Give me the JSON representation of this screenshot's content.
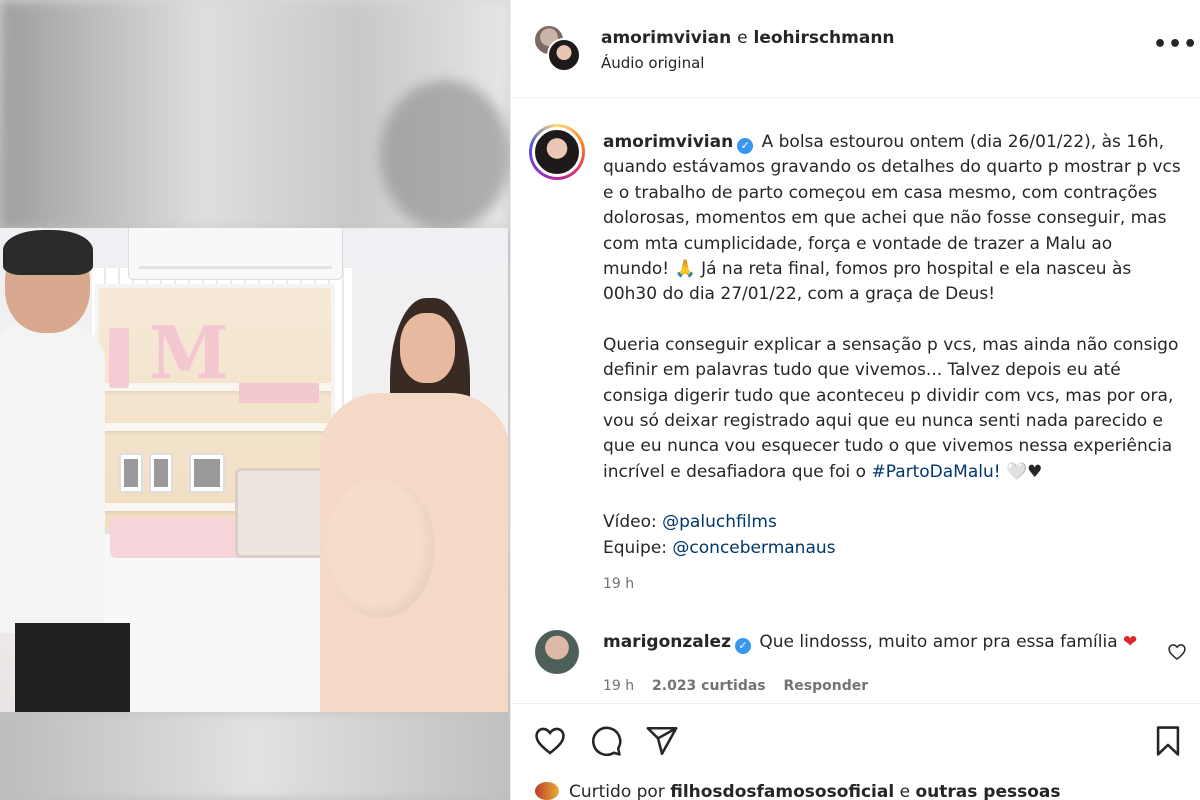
{
  "post": {
    "header": {
      "user1": "amorimvivian",
      "connector": "e",
      "user2": "leohirschmann",
      "audio": "Áudio original",
      "more_icon": "more-horizontal-icon"
    },
    "caption": {
      "username": "amorimvivian",
      "paragraph1": "A bolsa estourou ontem (dia 26/01/22), às 16h, quando estávamos gravando os detalhes do quarto p mostrar p vcs e o trabalho de parto começou em casa mesmo, com contrações dolorosas, momentos em que achei que não fosse conseguir, mas com mta cumplicidade, força e vontade de trazer a Malu ao mundo! 🙏 Já na reta final, fomos pro hospital e ela nasceu às 00h30 do dia 27/01/22, com a graça de Deus!",
      "paragraph2_text": "Queria conseguir explicar a sensação p vcs, mas ainda não consigo definir em palavras tudo que vivemos... Talvez depois eu até consiga digerir tudo que aconteceu p dividir com vcs, mas por ora, vou só deixar registrado aqui que eu nunca senti nada parecido e que eu nunca vou esquecer tudo o que vivemos nessa experiência incrível e desafiadora que foi o ",
      "hashtag": "#PartoDaMalu!",
      "paragraph2_end": " 🤍♥",
      "video_label": "Vídeo: ",
      "video_mention": "@paluchfilms",
      "team_label": "Equipe: ",
      "team_mention": "@concebermanaus",
      "time": "19 h"
    },
    "comment": {
      "username": "marigonzalez",
      "text": "Que lindosss, muito amor pra essa família",
      "emoji": "❤",
      "time": "19 h",
      "likes": "2.023 curtidas",
      "reply": "Responder"
    },
    "actions": {
      "like_icon": "heart-icon",
      "comment_icon": "comment-icon",
      "share_icon": "share-icon",
      "save_icon": "bookmark-icon"
    },
    "liked_by": {
      "prefix": "Curtido por",
      "user": "filhosdosfamososoficial",
      "connector": "e",
      "others": "outras pessoas"
    }
  }
}
